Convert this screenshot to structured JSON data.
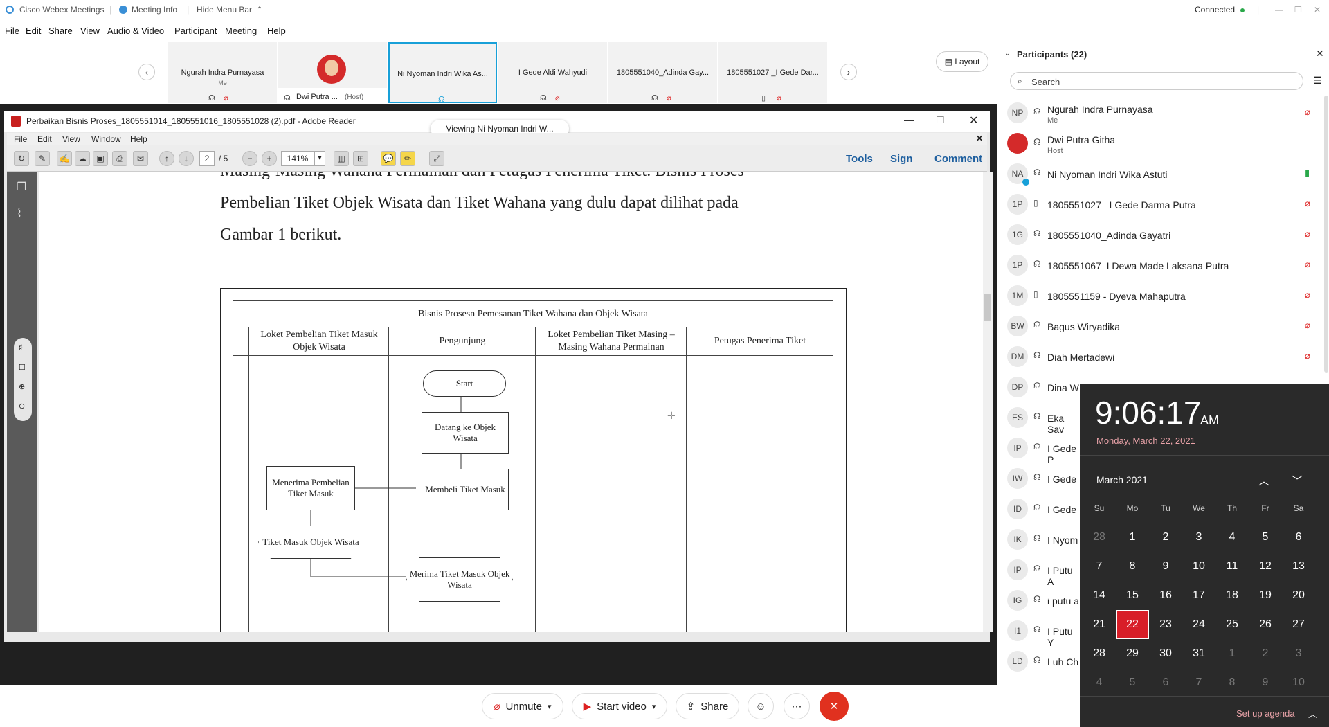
{
  "titlebar": {
    "app_name": "Cisco Webex Meetings",
    "meeting_info": "Meeting Info",
    "hide_menu_bar": "Hide Menu Bar",
    "status": "Connected"
  },
  "menubar": [
    "File",
    "Edit",
    "Share",
    "View",
    "Audio & Video",
    "Participant",
    "Meeting",
    "Help"
  ],
  "filmstrip": {
    "tiles": [
      {
        "name": "Ngurah Indra Purnayasa",
        "sub": "Me"
      },
      {
        "name": "Dwi Putra ...",
        "sub": "(Host)"
      },
      {
        "name": "Ni Nyoman Indri Wika As...",
        "sub": ""
      },
      {
        "name": "I Gede Aldi Wahyudi",
        "sub": ""
      },
      {
        "name": "1805551040_Adinda Gay...",
        "sub": ""
      },
      {
        "name": "1805551027 _I Gede Dar...",
        "sub": ""
      }
    ],
    "layout_label": "Layout"
  },
  "share": {
    "viewing_label": "Viewing Ni Nyoman Indri W...",
    "reader_title": "Perbaikan Bisnis Proses_1805551014_1805551016_1805551028 (2).pdf - Adobe Reader",
    "reader_menu": [
      "File",
      "Edit",
      "View",
      "Window",
      "Help"
    ],
    "page_current": "2",
    "page_total": "/ 5",
    "zoom": "141%",
    "right_tools": [
      "Tools",
      "Sign",
      "Comment"
    ]
  },
  "document": {
    "line1": "Masing-Masing Wahana Permainan dan Petugas Penerima Tiket. Bisnis Proses",
    "line2": "Pembelian Tiket Objek Wisata dan Tiket Wahana yang dulu dapat dilihat pada",
    "line3": "Gambar 1 berikut.",
    "diagram_title": "Bisnis Prosesn Pemesanan Tiket Wahana dan Objek Wisata",
    "lanes": [
      "Loket Pembelian Tiket Masuk Objek Wisata",
      "Pengunjung",
      "Loket Pembelian Tiket Masing – Masing Wahana Permainan",
      "Petugas Penerima Tiket"
    ],
    "nodes": {
      "start": "Start",
      "datang": "Datang ke Objek Wisata",
      "membeli": "Membeli Tiket Masuk",
      "menerima": "Menerima Pembelian Tiket Masuk",
      "tiket_masuk": "Tiket Masuk Objek Wisata",
      "merima": "Merima Tiket Masuk Objek Wisata"
    }
  },
  "controls": {
    "unmute": "Unmute",
    "start_video": "Start video",
    "share": "Share"
  },
  "participants": {
    "header": "Participants (22)",
    "search_placeholder": "Search",
    "list": [
      {
        "initials": "NP",
        "name": "Ngurah Indra Purnayasa",
        "role": "Me"
      },
      {
        "initials": "",
        "name": "Dwi Putra Githa",
        "role": "Host"
      },
      {
        "initials": "NA",
        "name": "Ni Nyoman Indri Wika Astuti",
        "role": ""
      },
      {
        "initials": "1P",
        "name": "1805551027 _I Gede Darma Putra",
        "role": ""
      },
      {
        "initials": "1G",
        "name": "1805551040_Adinda Gayatri",
        "role": ""
      },
      {
        "initials": "1P",
        "name": "1805551067_I Dewa Made Laksana Putra",
        "role": ""
      },
      {
        "initials": "1M",
        "name": "1805551159 - Dyeva Mahaputra",
        "role": ""
      },
      {
        "initials": "BW",
        "name": "Bagus Wiryadika",
        "role": ""
      },
      {
        "initials": "DM",
        "name": "Diah Mertadewi",
        "role": ""
      },
      {
        "initials": "DP",
        "name": "Dina W",
        "role": ""
      },
      {
        "initials": "ES",
        "name": "Eka Sav",
        "role": ""
      },
      {
        "initials": "IP",
        "name": "I Gede P",
        "role": ""
      },
      {
        "initials": "IW",
        "name": "I Gede",
        "role": ""
      },
      {
        "initials": "ID",
        "name": "I Gede",
        "role": ""
      },
      {
        "initials": "IK",
        "name": "I Nyom",
        "role": ""
      },
      {
        "initials": "IP",
        "name": "I Putu A",
        "role": ""
      },
      {
        "initials": "IG",
        "name": "i putu a",
        "role": ""
      },
      {
        "initials": "I1",
        "name": "I Putu Y",
        "role": ""
      },
      {
        "initials": "LD",
        "name": "Luh Ch",
        "role": ""
      }
    ]
  },
  "clock": {
    "time": "9:06:17",
    "ampm": "AM",
    "date": "Monday, March 22, 2021",
    "month": "March 2021",
    "weekdays": [
      "Su",
      "Mo",
      "Tu",
      "We",
      "Th",
      "Fr",
      "Sa"
    ],
    "days": [
      [
        "28",
        "1",
        "2",
        "3",
        "4",
        "5",
        "6"
      ],
      [
        "7",
        "8",
        "9",
        "10",
        "11",
        "12",
        "13"
      ],
      [
        "14",
        "15",
        "16",
        "17",
        "18",
        "19",
        "20"
      ],
      [
        "21",
        "22",
        "23",
        "24",
        "25",
        "26",
        "27"
      ],
      [
        "28",
        "29",
        "30",
        "31",
        "1",
        "2",
        "3"
      ],
      [
        "4",
        "5",
        "6",
        "7",
        "8",
        "9",
        "10"
      ]
    ],
    "today": "22",
    "agenda": "Set up agenda",
    "accent": "#d81e28"
  }
}
